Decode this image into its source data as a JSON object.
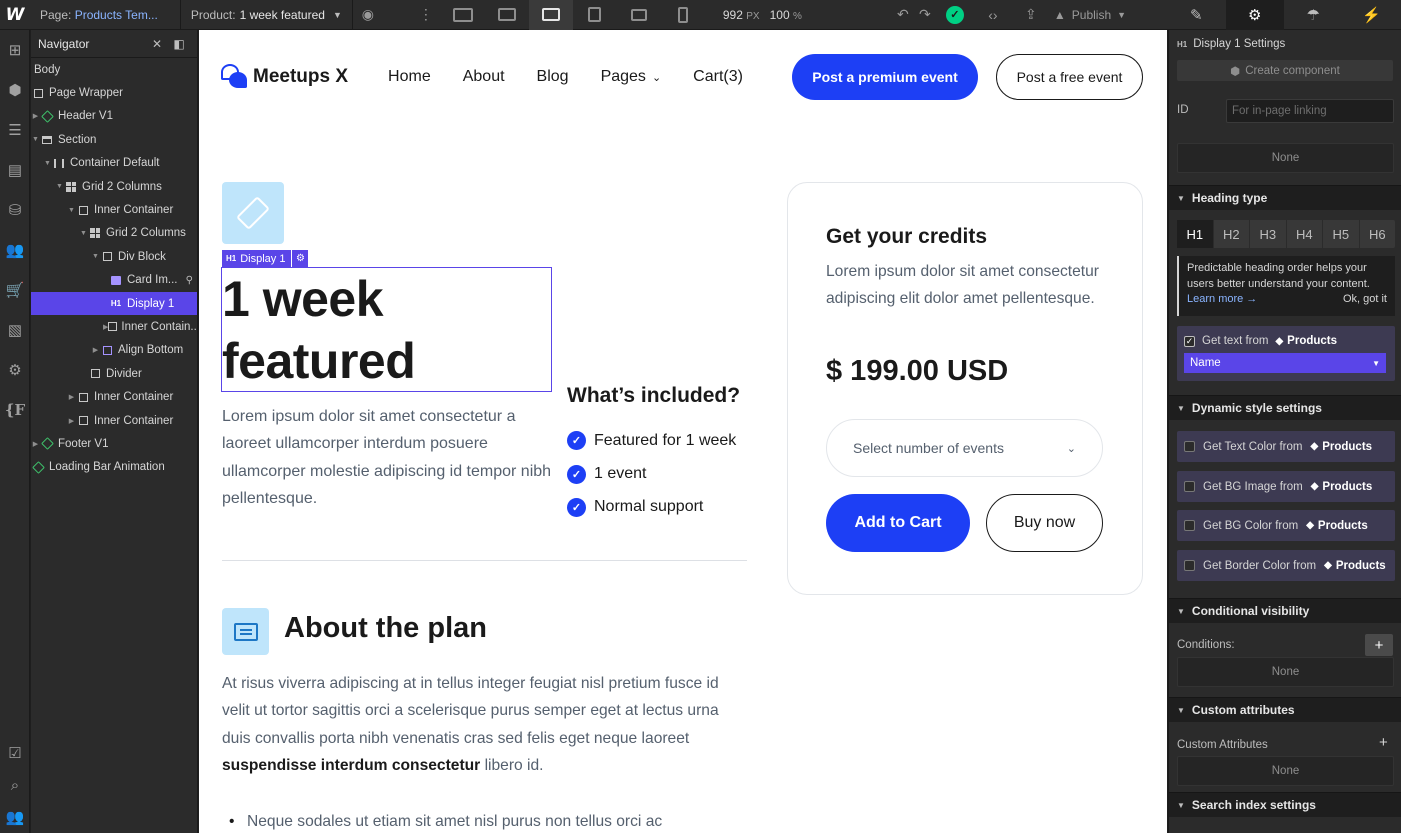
{
  "topbar": {
    "logo": "W",
    "page_label": "Page:",
    "page_value": "Products Tem...",
    "product_label": "Product:",
    "product_value": "1 week featured",
    "width_value": "992",
    "width_unit": "PX",
    "zoom": "100",
    "zoom_unit": "%",
    "publish_label": "Publish"
  },
  "navigator": {
    "title": "Navigator",
    "items": [
      {
        "label": "Body"
      },
      {
        "label": "Page Wrapper"
      },
      {
        "label": "Header V1"
      },
      {
        "label": "Section"
      },
      {
        "label": "Container Default"
      },
      {
        "label": "Grid 2 Columns"
      },
      {
        "label": "Inner Container"
      },
      {
        "label": "Grid 2 Columns"
      },
      {
        "label": "Div Block"
      },
      {
        "label": "Card Im..."
      },
      {
        "label": "Display 1"
      },
      {
        "label": "Inner Contain..."
      },
      {
        "label": "Align Bottom"
      },
      {
        "label": "Divider"
      },
      {
        "label": "Inner Container"
      },
      {
        "label": "Inner Container"
      },
      {
        "label": "Footer V1"
      },
      {
        "label": "Loading Bar Animation"
      }
    ]
  },
  "site": {
    "brand": "Meetups X",
    "nav": [
      "Home",
      "About",
      "Blog",
      "Pages",
      "Cart(3)"
    ],
    "cta_primary": "Post a premium event",
    "cta_secondary": "Post a free event",
    "selected_label": "Display 1",
    "selected_tag": "H1",
    "title": "1 week featured",
    "lead": "Lorem ipsum dolor sit amet consectetur a laoreet ullamcorper interdum posuere ullamcorper molestie adipiscing id tempor nibh pellentesque.",
    "included_title": "What’s included?",
    "included": [
      "Featured for 1 week",
      "1 event",
      "Normal support"
    ],
    "about_title": "About the plan",
    "about_p_start": "At risus viverra adipiscing at in tellus integer feugiat nisl pretium fusce id velit ut tortor sagittis orci a scelerisque purus semper eget at lectus urna duis convallis porta nibh venenatis cras sed felis eget neque laoreet ",
    "about_p_bold": "suspendisse interdum consectetur",
    "about_p_end": " libero id.",
    "bullet_1": "Neque sodales ut etiam sit amet nisl purus non tellus orci ac",
    "card": {
      "title": "Get your credits",
      "text": "Lorem ipsum dolor sit amet consectetur adipiscing elit dolor amet pellentesque.",
      "price": "$ 199.00 USD",
      "select_placeholder": "Select number of events",
      "add_to_cart": "Add to Cart",
      "buy_now": "Buy now"
    }
  },
  "panel": {
    "header_tag": "H1",
    "header_title": "Display 1 Settings",
    "create_component": "Create component",
    "id_label": "ID",
    "id_placeholder": "For in-page linking",
    "none": "None",
    "heading_type_title": "Heading type",
    "heading_tabs": [
      "H1",
      "H2",
      "H3",
      "H4",
      "H5",
      "H6"
    ],
    "heading_active": "H1",
    "tip_text": "Predictable heading order helps your users better understand your content.",
    "tip_learn": "Learn more →",
    "tip_ok": "Ok, got it",
    "get_text_from": "Get text from",
    "collection": "Products",
    "field_value": "Name",
    "dynamic_title": "Dynamic style settings",
    "dynamic_rows": [
      "Get Text Color from",
      "Get BG Image from",
      "Get BG Color from",
      "Get Border Color from"
    ],
    "conditional_title": "Conditional visibility",
    "conditions_label": "Conditions:",
    "custom_attr_title": "Custom attributes",
    "custom_attr_label": "Custom Attributes",
    "search_index_title": "Search index settings"
  },
  "colors": {
    "accent": "#1d3ff5",
    "selection": "#5a45e8",
    "tile": "#bfe5fb",
    "success": "#00d084"
  }
}
